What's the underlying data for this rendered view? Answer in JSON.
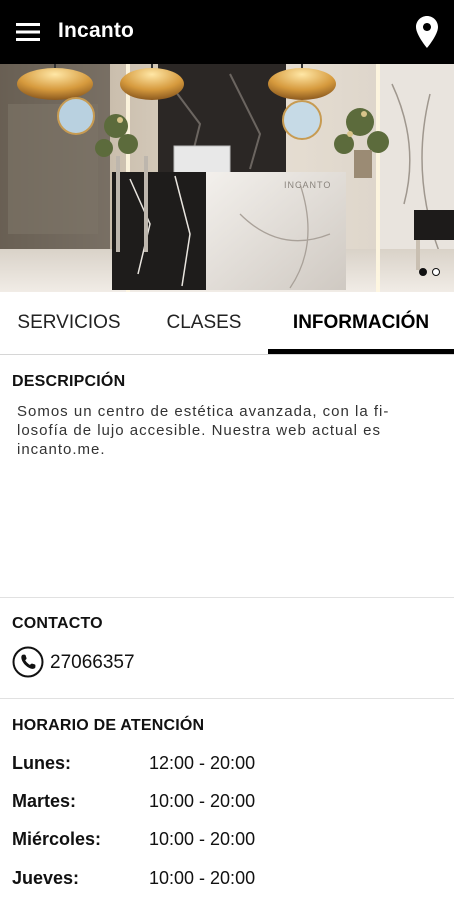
{
  "app": {
    "title": "Incanto"
  },
  "colors": {
    "appbar": "#000000",
    "accent": "#000000"
  },
  "icons": {
    "menu": "hamburger-menu-icon",
    "location": "location-pin-icon",
    "phone": "phone-icon"
  },
  "carousel": {
    "slide_count": 2,
    "active_index": 0
  },
  "tabs": [
    {
      "label": "SERVICIOS",
      "active": false
    },
    {
      "label": "CLASES",
      "active": false
    },
    {
      "label": "INFORMACIÓN",
      "active": true
    }
  ],
  "descripcion": {
    "heading": "DESCRIPCIÓN",
    "line1": "Somos un centro de estética avanzada, con la fi-",
    "line2": "losofía de lujo accesible. Nuestra web actual es",
    "line3": "incanto.me."
  },
  "contacto": {
    "heading": "CONTACTO",
    "phone": "27066357"
  },
  "horario": {
    "heading": "HORARIO DE ATENCIÓN",
    "rows": [
      {
        "day": "Lunes:",
        "time": "12:00 - 20:00"
      },
      {
        "day": "Martes:",
        "time": "10:00 - 20:00"
      },
      {
        "day": "Miércoles:",
        "time": "10:00 - 20:00"
      },
      {
        "day": "Jueves:",
        "time": "10:00 - 20:00"
      }
    ]
  }
}
